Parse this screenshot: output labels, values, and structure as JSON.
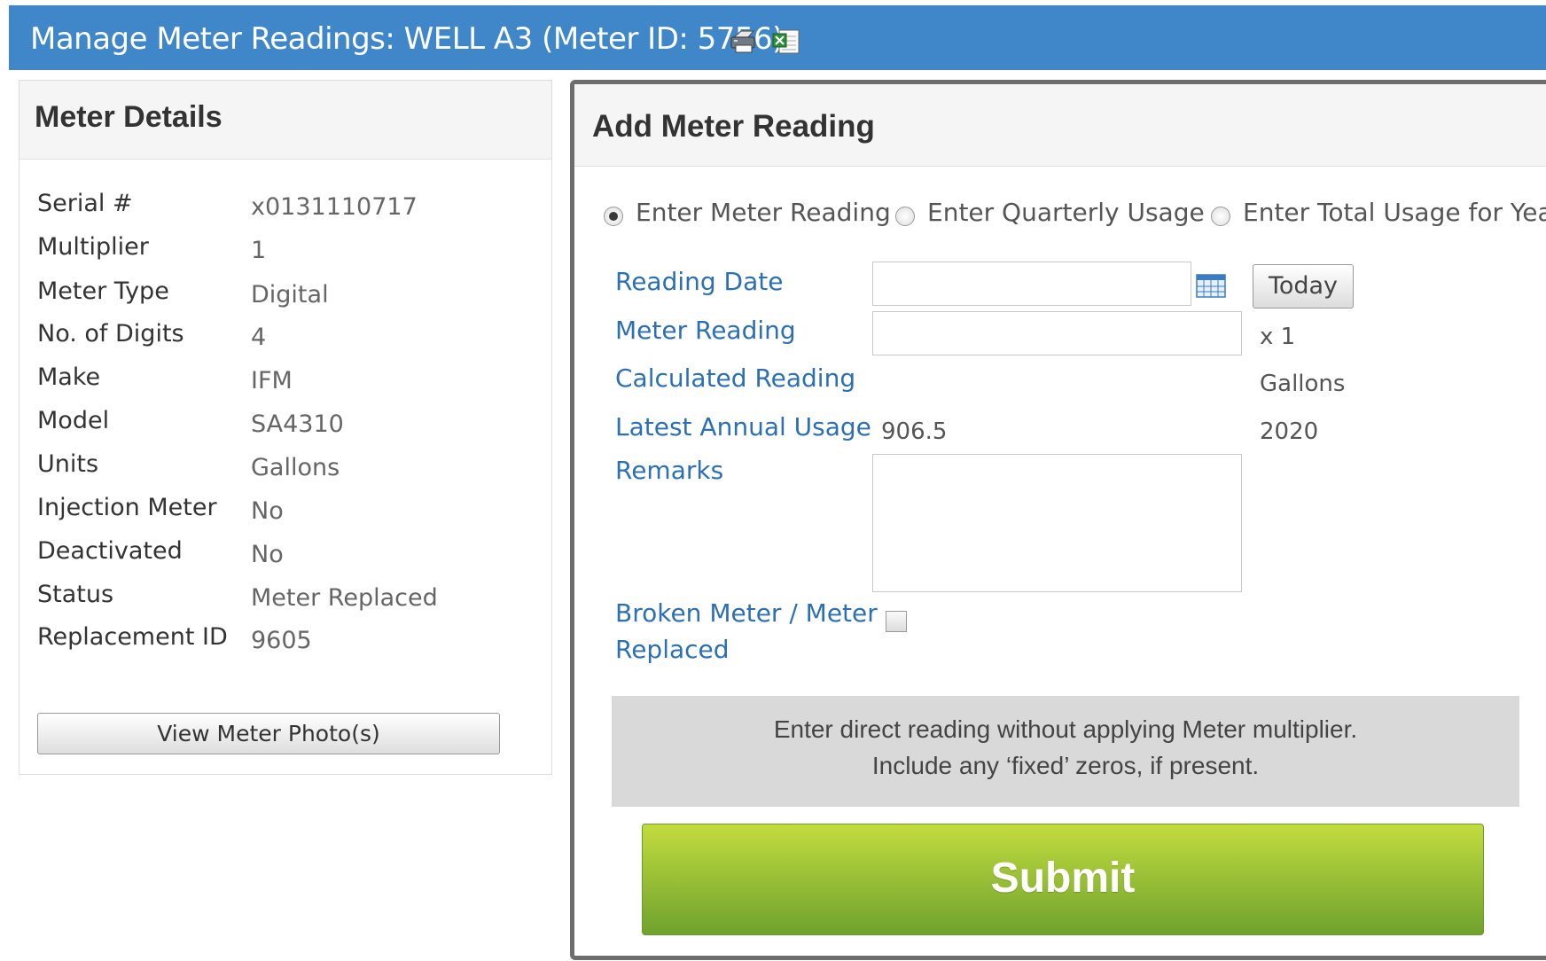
{
  "header": {
    "title": "Manage Meter Readings: WELL A3 (Meter ID: 5756)",
    "icons": [
      "print-icon",
      "excel-export-icon"
    ],
    "color": "#3f87c8"
  },
  "meter_details": {
    "title": "Meter Details",
    "rows": [
      {
        "label": "Serial #",
        "value": "x0131110717"
      },
      {
        "label": "Multiplier",
        "value": "1"
      },
      {
        "label": "Meter Type",
        "value": "Digital"
      },
      {
        "label": "No. of Digits",
        "value": "4"
      },
      {
        "label": "Make",
        "value": "IFM"
      },
      {
        "label": "Model",
        "value": "SA4310"
      },
      {
        "label": "Units",
        "value": "Gallons"
      },
      {
        "label": "Injection Meter",
        "value": "No"
      },
      {
        "label": "Deactivated",
        "value": "No"
      },
      {
        "label": "Status",
        "value": "Meter Replaced"
      },
      {
        "label": "Replacement ID",
        "value": "9605"
      }
    ],
    "photo_button": "View Meter Photo(s)"
  },
  "add_reading": {
    "title": "Add Meter Reading",
    "modes": [
      {
        "label": "Enter Meter Reading",
        "selected": true
      },
      {
        "label": "Enter Quarterly Usage",
        "selected": false
      },
      {
        "label": "Enter Total Usage for Year",
        "selected": false
      }
    ],
    "reading_date": {
      "label": "Reading Date",
      "value": "",
      "today_button": "Today",
      "icon": "calendar-icon"
    },
    "meter_reading": {
      "label": "Meter Reading",
      "value": "",
      "multiplier_text": "x 1"
    },
    "calculated_reading": {
      "label": "Calculated Reading",
      "value": "",
      "units": "Gallons"
    },
    "latest_annual_usage": {
      "label": "Latest Annual Usage",
      "value": "906.5",
      "year": "2020"
    },
    "remarks": {
      "label": "Remarks",
      "value": ""
    },
    "broken_meter": {
      "label_line1": "Broken Meter / Meter",
      "label_line2": "Replaced",
      "checked": false
    },
    "info": {
      "line1": "Enter direct reading without applying Meter multiplier.",
      "line2": "Include any ‘fixed’ zeros, if present."
    },
    "submit_label": "Submit",
    "submit_color": "#8dbb34"
  }
}
